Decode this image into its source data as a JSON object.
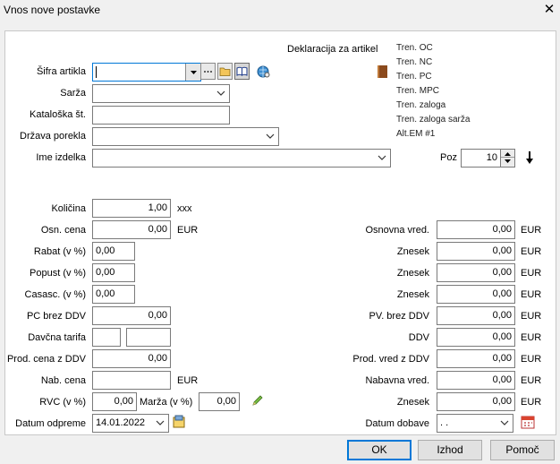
{
  "window": {
    "title": "Vnos nove postavke"
  },
  "header": {
    "declaration_label": "Deklaracija za artikel"
  },
  "info_list": [
    "Tren. OC",
    "Tren. NC",
    "Tren. PC",
    "Tren. MPC",
    "Tren. zaloga",
    "Tren. zaloga sarža",
    "Alt.EM #1"
  ],
  "fields": {
    "sifra_label": "Šifra artikla",
    "sifra_value": "",
    "sarza_label": "Sarža",
    "sarza_value": "",
    "kataloska_label": "Kataloška št.",
    "kataloska_value": "",
    "drzava_label": "Država porekla",
    "drzava_value": "",
    "ime_label": "Ime izdelka",
    "ime_value": "",
    "poz_label": "Poz",
    "poz_value": "10"
  },
  "left": {
    "kolicina_label": "Količina",
    "kolicina_value": "1,00",
    "kolicina_unit": "xxx",
    "osn_cena_label": "Osn. cena",
    "osn_cena_value": "0,00",
    "osn_cena_unit": "EUR",
    "rabat_label": "Rabat (v %)",
    "rabat_value": "0,00",
    "popust_label": "Popust (v %)",
    "popust_value": "0,00",
    "casasc_label": "Casasc. (v %)",
    "casasc_value": "0,00",
    "pc_brez_label": "PC brez DDV",
    "pc_brez_value": "0,00",
    "davcna_label": "Davčna tarifa",
    "prod_cena_label": "Prod. cena z DDV",
    "prod_cena_value": "0,00",
    "nab_cena_label": "Nab. cena",
    "nab_cena_value": "",
    "nab_cena_unit": "EUR",
    "rvc_label": "RVC (v %)",
    "rvc_value": "0,00",
    "marza_label": "Marža (v %)",
    "marza_value": "0,00",
    "datum_odpreme_label": "Datum odpreme",
    "datum_odpreme_value": "14.01.2022"
  },
  "right": {
    "osnovna_label": "Osnovna vred.",
    "osnovna_value": "0,00",
    "currency": "EUR",
    "znesek1_label": "Znesek",
    "znesek1_value": "0,00",
    "znesek2_label": "Znesek",
    "znesek2_value": "0,00",
    "znesek3_label": "Znesek",
    "znesek3_value": "0,00",
    "pv_brez_label": "PV. brez DDV",
    "pv_brez_value": "0,00",
    "ddv_label": "DDV",
    "ddv_value": "0,00",
    "prod_vred_label": "Prod. vred z DDV",
    "prod_vred_value": "0,00",
    "nabavna_label": "Nabavna vred.",
    "nabavna_value": "0,00",
    "znesek4_label": "Znesek",
    "znesek4_value": "0,00",
    "datum_dobave_label": "Datum dobave",
    "datum_dobave_value": ". ."
  },
  "buttons": {
    "ok": "OK",
    "izhod": "Izhod",
    "pomoc": "Pomoč"
  },
  "colors": {
    "accent": "#0078d7",
    "panel": "#ffffff",
    "window": "#f0f0f0"
  }
}
